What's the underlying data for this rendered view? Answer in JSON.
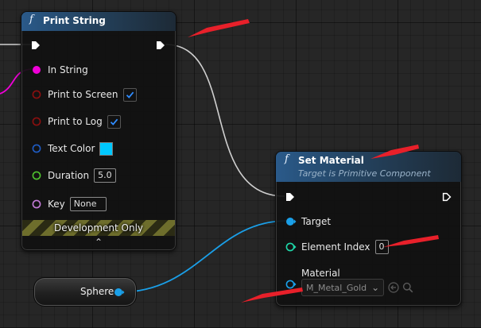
{
  "print_string_node": {
    "fn_glyph": "f",
    "title": "Print String",
    "pins": {
      "in_string": "In String",
      "print_to_screen": "Print to Screen",
      "print_to_log": "Print to Log",
      "text_color": "Text Color",
      "duration": "Duration",
      "duration_value": "5.0",
      "key": "Key",
      "key_value": "None"
    },
    "development_only": "Development Only",
    "expand_glyph": "⌃",
    "print_to_screen_checked": true,
    "print_to_log_checked": true,
    "text_color_value": "#00C8FF"
  },
  "set_material_node": {
    "fn_glyph": "f",
    "title": "Set Material",
    "subtitle": "Target is Primitive Component",
    "pins": {
      "target": "Target",
      "element_index": "Element Index",
      "element_index_value": "0",
      "material": "Material",
      "material_value": "M_Metal_Gold",
      "dropdown_glyph": "⌄"
    }
  },
  "sphere_node": {
    "label": "Sphere"
  },
  "colors": {
    "exec_wire": "#d0d0d0",
    "object_pin": "#1a9fe8",
    "string_pin": "#f000d8",
    "bool_pin": "#8a0f0f",
    "struct_pin": "#1f5cc4",
    "float_pin": "#4ec22e",
    "name_pin": "#c47ad8",
    "int_pin": "#1ed6a8",
    "annotation_arrow": "#e8202a"
  },
  "icons": [
    "exec-in-pin-icon",
    "exec-out-pin-icon",
    "checkmark-icon",
    "browse-arrow-icon",
    "search-icon"
  ]
}
